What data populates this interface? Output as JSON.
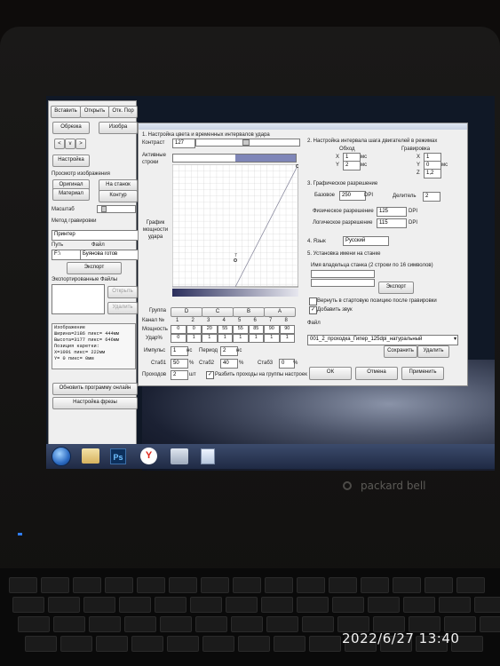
{
  "colors": {
    "accent": "#7f86b8",
    "window_bg": "#efefef",
    "taskbar": "#2b3a59"
  },
  "main_window": {
    "toolbar": {
      "insert": "Вставить",
      "open": "Открыть",
      "partial": "Отк. Пор"
    },
    "buttons": {
      "crop": "Обрезка",
      "image": "Изобра",
      "settings": "Настройка"
    },
    "preview": {
      "heading": "Просмотр изображения",
      "original": "Оригинал",
      "on_machine": "На станок",
      "material": "Материал",
      "contour": "Контур"
    },
    "scale_label": "Масштаб",
    "engrave_method_label": "Метод гравировки",
    "method_value": "Принтер",
    "path_label": "Путь",
    "file_label": "Файл",
    "drive_value": "F:\\",
    "file_value": "Буянова готов",
    "export_button": "Экспорт",
    "exported_files_label": "Экспортированные Файлы",
    "ghost_buttons": {
      "button1": "Открыть",
      "button2": "Удалить"
    },
    "info_lines": [
      "Изображение",
      "Ширина=2186 пикс= 444мм",
      "Высота=3177 пикс= 646мм",
      "Позиция каретки:",
      "X=1091 пикс= 222мм",
      "Y=   0 пикс=   0мм"
    ],
    "update_button": "Обновить программу онлайн",
    "mill_settings_button": "Настройка фрезы"
  },
  "dialog": {
    "section1_title": "1. Настройка цвета и временных интервалов удара",
    "contrast_label": "Контраст",
    "contrast_value": "127",
    "active_strings_label": "Активные строки",
    "graph_label": "График мощности удара",
    "graph_point_label": "7",
    "curve": {
      "points": [
        [
          0,
          0
        ],
        [
          0.5,
          0
        ],
        [
          1,
          1
        ]
      ]
    },
    "group_label": "Группа",
    "groups": [
      "D",
      "C",
      "B",
      "A"
    ],
    "channel_label": "Канал №",
    "channels": [
      "1",
      "2",
      "3",
      "4",
      "5",
      "6",
      "7",
      "8"
    ],
    "power_label": "Мощность",
    "power_values": [
      "0",
      "0",
      "20",
      "55",
      "55",
      "85",
      "90",
      "90"
    ],
    "strike_label": "Удар%",
    "strike_values": [
      "0",
      "1",
      "1",
      "1",
      "1",
      "1",
      "1",
      "1"
    ],
    "impulse_label": "Импульс",
    "impulse_value": "1",
    "impulse_unit": "нс",
    "period_label": "Период",
    "period_value": "2",
    "period_unit": "нс",
    "stab1_label": "Стаб1",
    "stab1_value": "50",
    "stab1_unit": "%",
    "stab2_label": "Стаб2",
    "stab2_value": "40",
    "stab2_unit": "%",
    "stab3_label": "Стаб3",
    "stab3_value": "0",
    "stab3_unit": "%",
    "passes_label": "Проходов",
    "passes_value": "2",
    "passes_unit": "шт",
    "split_passes_label": "Разбить проходы на группы настроек",
    "section2_title": "2. Настройка интервала шага двигателей в режимах",
    "bypass_label": "Обход",
    "engraving_label": "Гравировка",
    "bypass_x": "1",
    "bypass_y": "2",
    "bypass_unit": "мс",
    "engrave_x": "1",
    "engrave_y": "0",
    "engrave_z": "1,2",
    "engrave_unit": "мс",
    "section3_title": "3. Графическое разрешение",
    "base_label": "Базовое",
    "base_value": "250",
    "dpi": "DPI",
    "divider_label": "Делитель",
    "divider_value": "2",
    "physical_label": "Физическое разрешение",
    "physical_value": "125",
    "logical_label": "Логическое разрешение",
    "logical_value": "115",
    "section4_title": "4. Язык",
    "language_value": "Русский",
    "section5_title": "5. Установка имени на станке",
    "owner_label": "Имя владельца станка (2 строки по 16 символов)",
    "export_button": "Экспорт",
    "return_label": "Вернуть в стартовую позицию после гравировки",
    "add_sound_label": "Добавить звук",
    "file_label": "Файл",
    "file_value": "001_2_проходка_Гипер_125dpi_натуральный",
    "save_button": "Сохранить",
    "delete_button": "Удалить",
    "ok_button": "ОК",
    "cancel_button": "Отмена",
    "apply_button": "Применить"
  },
  "taskbar": {
    "apps": [
      "start-orb",
      "explorer",
      "photoshop",
      "yandex-browser",
      "app-arrow",
      "notepad"
    ]
  },
  "laptop_brand": "packard bell",
  "photo_timestamp": "2022/6/27 13:40"
}
